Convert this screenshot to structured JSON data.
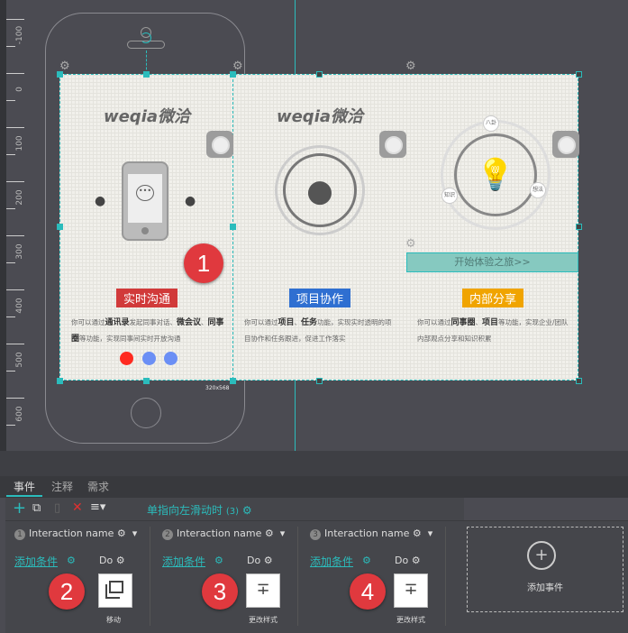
{
  "ruler": {
    "labels": [
      "-100",
      "0",
      "100",
      "200",
      "300",
      "400",
      "500",
      "600"
    ]
  },
  "slides": [
    {
      "logo": "weqia微洽",
      "badge": "实时沟通",
      "badge_color": "#d13a3a",
      "desc_html": [
        "你可以通过",
        "通讯录",
        "发起同事对话、",
        "微会议",
        "、",
        "同事圈",
        "等功能，实现同事间实时开放沟通"
      ]
    },
    {
      "logo": "weqia微洽",
      "badge": "项目协作",
      "badge_color": "#2f6fd1",
      "desc_html": [
        "你可以通过",
        "项目",
        "、",
        "任务",
        "功能，实现实时透明的项目协作和任务跟进，促进工作落实"
      ]
    },
    {
      "badge": "内部分享",
      "badge_color": "#f0a400",
      "desc_html": [
        "你可以通过",
        "同事圈",
        "、",
        "项目",
        "等功能，实现企业/团队内部观点分享和知识积累"
      ],
      "cta": "开始体验之旅>>",
      "orbit_labels": [
        "八卦",
        "想法",
        "知识"
      ]
    }
  ],
  "pagination_colors": [
    "#ff2a20",
    "#6b8ff5",
    "#6b8ff5"
  ],
  "size_label": "320x568",
  "markers": [
    "1",
    "2",
    "3",
    "4"
  ],
  "tabs": [
    "事件",
    "注释",
    "需求"
  ],
  "event": {
    "name": "单指向左滑动时",
    "count": "(3)"
  },
  "interactions": [
    {
      "num": "1",
      "name": "Interaction name",
      "cond": "添加条件",
      "do": "Do",
      "action": "移动",
      "icon": "move-icon"
    },
    {
      "num": "2",
      "name": "Interaction name",
      "cond": "添加条件",
      "do": "Do",
      "action": "更改样式",
      "icon": "style-icon"
    },
    {
      "num": "3",
      "name": "Interaction name",
      "cond": "添加条件",
      "do": "Do",
      "action": "更改样式",
      "icon": "style-icon"
    }
  ],
  "add_event": "添加事件",
  "accent": "#2bbcbc"
}
